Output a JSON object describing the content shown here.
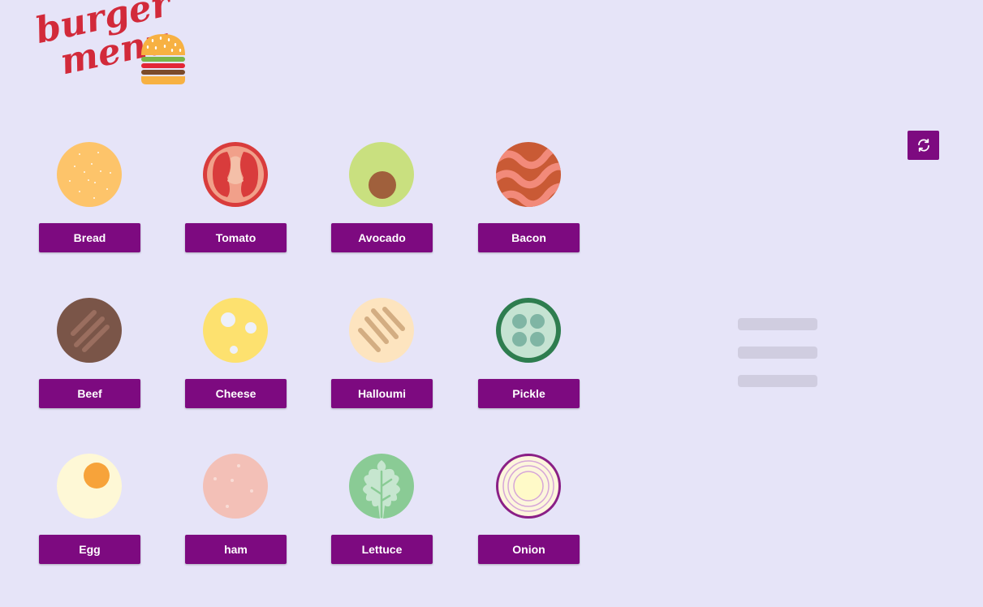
{
  "app": {
    "logo_line1": "burger",
    "logo_line2": "menu",
    "logo_icon": "burger-icon"
  },
  "ingredients": [
    {
      "label": "Bread",
      "icon": "bread-icon"
    },
    {
      "label": "Tomato",
      "icon": "tomato-icon"
    },
    {
      "label": "Avocado",
      "icon": "avocado-icon"
    },
    {
      "label": "Bacon",
      "icon": "bacon-icon"
    },
    {
      "label": "Beef",
      "icon": "beef-icon"
    },
    {
      "label": "Cheese",
      "icon": "cheese-icon"
    },
    {
      "label": "Halloumi",
      "icon": "halloumi-icon"
    },
    {
      "label": "Pickle",
      "icon": "pickle-icon"
    },
    {
      "label": "Egg",
      "icon": "egg-icon"
    },
    {
      "label": "ham",
      "icon": "ham-icon"
    },
    {
      "label": "Lettuce",
      "icon": "lettuce-icon"
    },
    {
      "label": "Onion",
      "icon": "onion-icon"
    }
  ],
  "toolbar": {
    "refresh_icon": "refresh-icon"
  },
  "colors": {
    "background": "#e6e4f8",
    "button": "#7d0a80",
    "logo": "#d22a3a",
    "placeholder": "#d0cde0"
  }
}
